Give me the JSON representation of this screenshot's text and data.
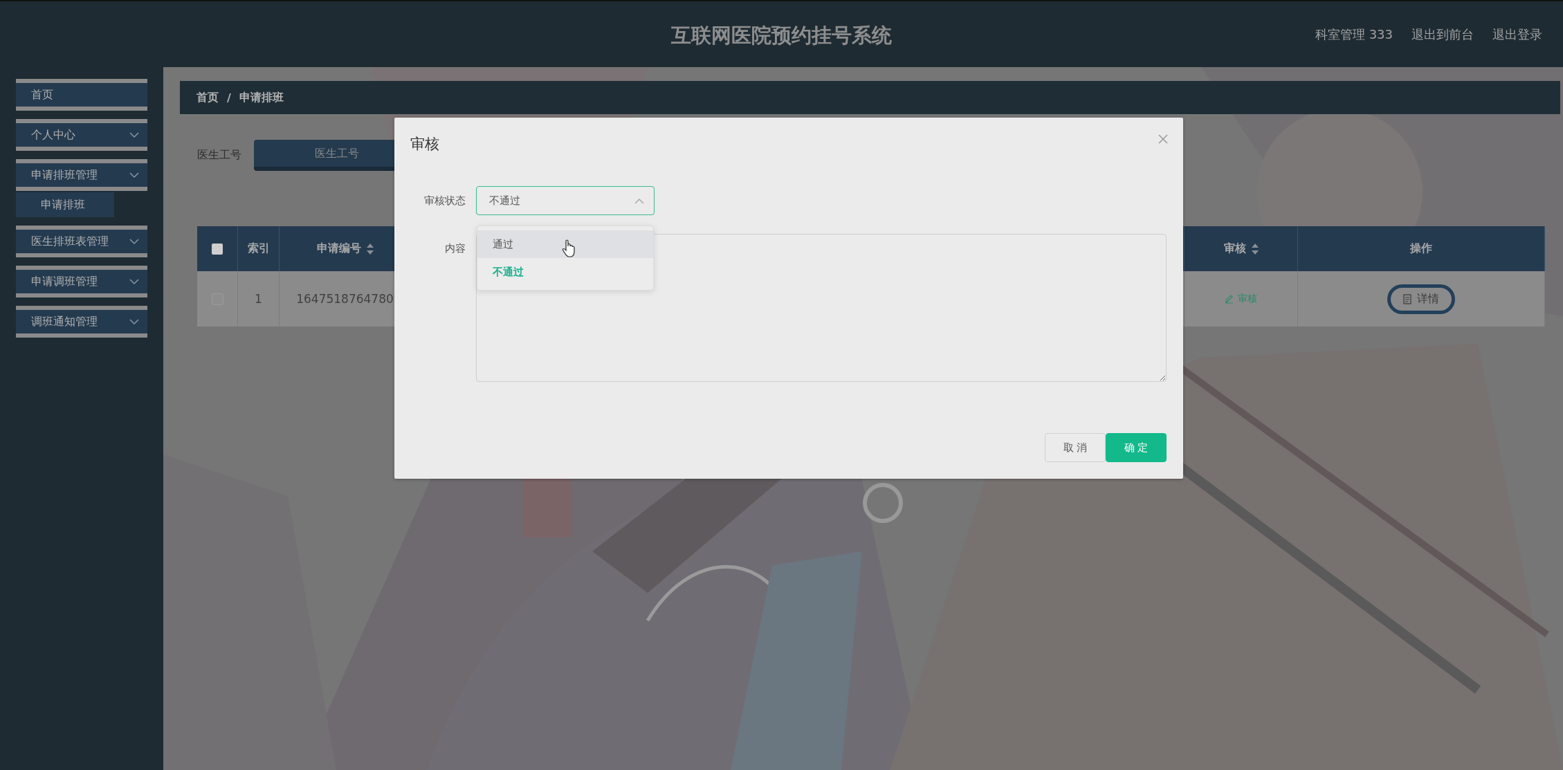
{
  "header": {
    "title": "互联网医院预约挂号系统",
    "links": [
      "科室管理 333",
      "退出到前台",
      "退出登录"
    ]
  },
  "sidebar": {
    "items": [
      {
        "label": "首页",
        "kind": "link"
      },
      {
        "label": "个人中心",
        "kind": "menu"
      },
      {
        "label": "申请排班管理",
        "kind": "menu",
        "children": [
          {
            "label": "申请排班"
          }
        ]
      },
      {
        "label": "医生排班表管理",
        "kind": "menu"
      },
      {
        "label": "申请调班管理",
        "kind": "menu"
      },
      {
        "label": "调班通知管理",
        "kind": "menu"
      }
    ]
  },
  "breadcrumb": {
    "items": [
      "首页",
      "申请排班"
    ],
    "separator": "/"
  },
  "search": {
    "label": "医生工号",
    "placeholder": "医生工号"
  },
  "table": {
    "select_all_checked": false,
    "columns": [
      {
        "label": "索引",
        "sortable": false
      },
      {
        "label": "申请编号",
        "sortable": true
      },
      {
        "label": "审核",
        "sortable": true
      },
      {
        "label": "操作",
        "sortable": false
      }
    ],
    "rows": [
      {
        "checked": false,
        "cells": [
          "1",
          "1647518764780"
        ],
        "review_link": "审核",
        "detail_button": "详情"
      }
    ]
  },
  "dialog": {
    "title": "审核",
    "status": {
      "label": "审核状态",
      "value": "不通过",
      "open": true,
      "options": [
        {
          "label": "通过",
          "selected": false,
          "hovered": true
        },
        {
          "label": "不通过",
          "selected": true,
          "hovered": false
        }
      ]
    },
    "content": {
      "label": "内容"
    },
    "buttons": {
      "cancel": "取消",
      "confirm": "确定"
    }
  }
}
